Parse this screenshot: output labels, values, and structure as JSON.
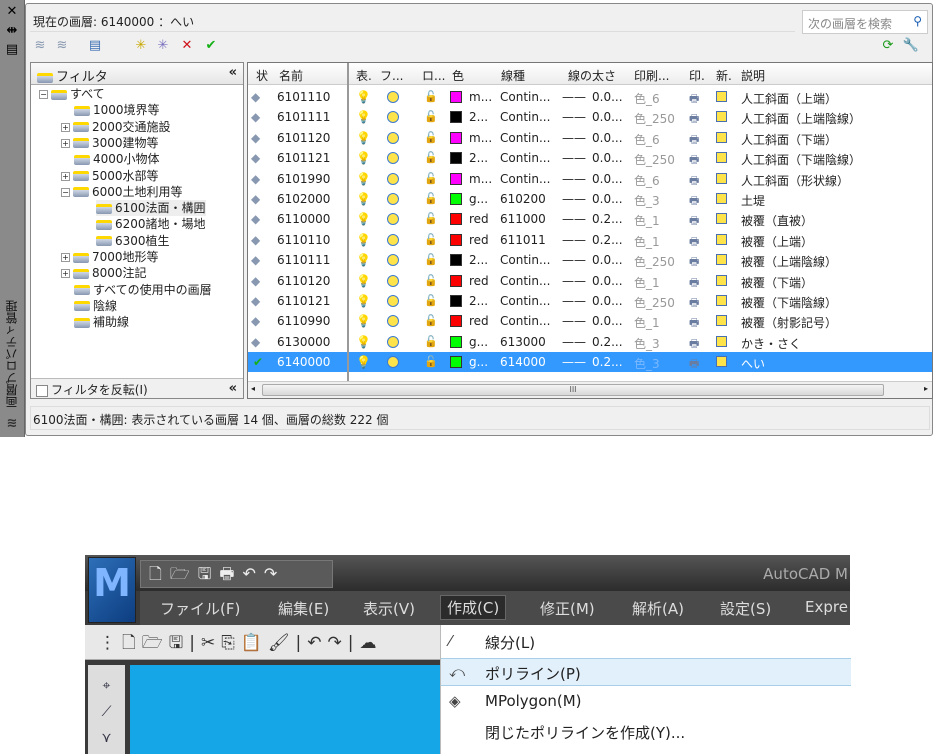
{
  "side_panel": {
    "title": "画層プロパティ管理",
    "close_icon": "✕",
    "autohide_icon": "⇹",
    "props_icon": "▤"
  },
  "current_layer": "現在の画層:  6140000  ：へい",
  "search": {
    "placeholder": "次の画層を検索"
  },
  "filter": {
    "title": "フィルタ",
    "collapse": "«",
    "invert_label": "フィルタを反転(I)",
    "tree": [
      {
        "label": "すべて",
        "pm": "−"
      },
      {
        "label": "1000境界等",
        "pm": ""
      },
      {
        "label": "2000交通施設",
        "pm": "+"
      },
      {
        "label": "3000建物等",
        "pm": "+"
      },
      {
        "label": "4000小物体",
        "pm": ""
      },
      {
        "label": "5000水部等",
        "pm": "+"
      },
      {
        "label": "6000土地利用等",
        "pm": "−"
      },
      {
        "label": "6100法面・構囲",
        "pm": ""
      },
      {
        "label": "6200諸地・場地",
        "pm": ""
      },
      {
        "label": "6300植生",
        "pm": ""
      },
      {
        "label": "7000地形等",
        "pm": "+"
      },
      {
        "label": "8000注記",
        "pm": "+"
      },
      {
        "label": "すべての使用中の画層",
        "pm": ""
      },
      {
        "label": "陰線",
        "pm": ""
      },
      {
        "label": "補助線",
        "pm": ""
      }
    ]
  },
  "grid": {
    "headers": [
      "状",
      "名前",
      "表.",
      "フ...",
      "ロ...",
      "色",
      "線種",
      "線の太さ",
      "印刷...",
      "印.",
      "新.",
      "説明"
    ],
    "rows": [
      [
        "6101110",
        "m...",
        "#ff00ff",
        "Contin...",
        "0.0...",
        "色_6",
        "人工斜面（上端）"
      ],
      [
        "6101111",
        "2...",
        "#000000",
        "Contin...",
        "0.0...",
        "色_250",
        "人工斜面（上端陰線）"
      ],
      [
        "6101120",
        "m...",
        "#ff00ff",
        "Contin...",
        "0.0...",
        "色_6",
        "人工斜面（下端）"
      ],
      [
        "6101121",
        "2...",
        "#000000",
        "Contin...",
        "0.0...",
        "色_250",
        "人工斜面（下端陰線）"
      ],
      [
        "6101990",
        "m...",
        "#ff00ff",
        "Contin...",
        "0.0...",
        "色_6",
        "人工斜面（形状線）"
      ],
      [
        "6102000",
        "g...",
        "#00ff00",
        "610200",
        "0.0...",
        "色_3",
        "土堤"
      ],
      [
        "6110000",
        "red",
        "#ff0000",
        "611000",
        "0.2...",
        "色_1",
        "被覆（直被）"
      ],
      [
        "6110110",
        "red",
        "#ff0000",
        "611011",
        "0.2...",
        "色_1",
        "被覆（上端）"
      ],
      [
        "6110111",
        "2...",
        "#000000",
        "Contin...",
        "0.0...",
        "色_250",
        "被覆（上端陰線）"
      ],
      [
        "6110120",
        "red",
        "#ff0000",
        "Contin...",
        "0.0...",
        "色_1",
        "被覆（下端）"
      ],
      [
        "6110121",
        "2...",
        "#000000",
        "Contin...",
        "0.0...",
        "色_250",
        "被覆（下端陰線）"
      ],
      [
        "6110990",
        "red",
        "#ff0000",
        "Contin...",
        "0.0...",
        "色_1",
        "被覆（射影記号）"
      ],
      [
        "6130000",
        "g...",
        "#00ff00",
        "613000",
        "0.2...",
        "色_3",
        "かき・さく"
      ],
      [
        "6140000",
        "g...",
        "#00ff00",
        "614000",
        "0.2...",
        "色_3",
        "へい"
      ]
    ],
    "selected_index": 13,
    "scroll_grip": "III"
  },
  "status": "6100法面・構囲:  表示されている画層  14  個、画層の総数  222  個",
  "autocad": {
    "logo": "M",
    "title": "AutoCAD M",
    "menus": [
      "ファイル(F)",
      "編集(E)",
      "表示(V)",
      "作成(C)",
      "修正(M)",
      "解析(A)",
      "設定(S)",
      "Expre"
    ],
    "dropdown": [
      {
        "icon": "line-icon",
        "glyph": "⁄",
        "label": "線分(L)"
      },
      {
        "icon": "polyline-icon",
        "glyph": "⤺",
        "label": "ポリライン(P)"
      },
      {
        "icon": "mpolygon-icon",
        "glyph": "◈",
        "label": "MPolygon(M)"
      },
      {
        "icon": "",
        "glyph": "",
        "label": "閉じたポリラインを作成(Y)..."
      }
    ]
  }
}
